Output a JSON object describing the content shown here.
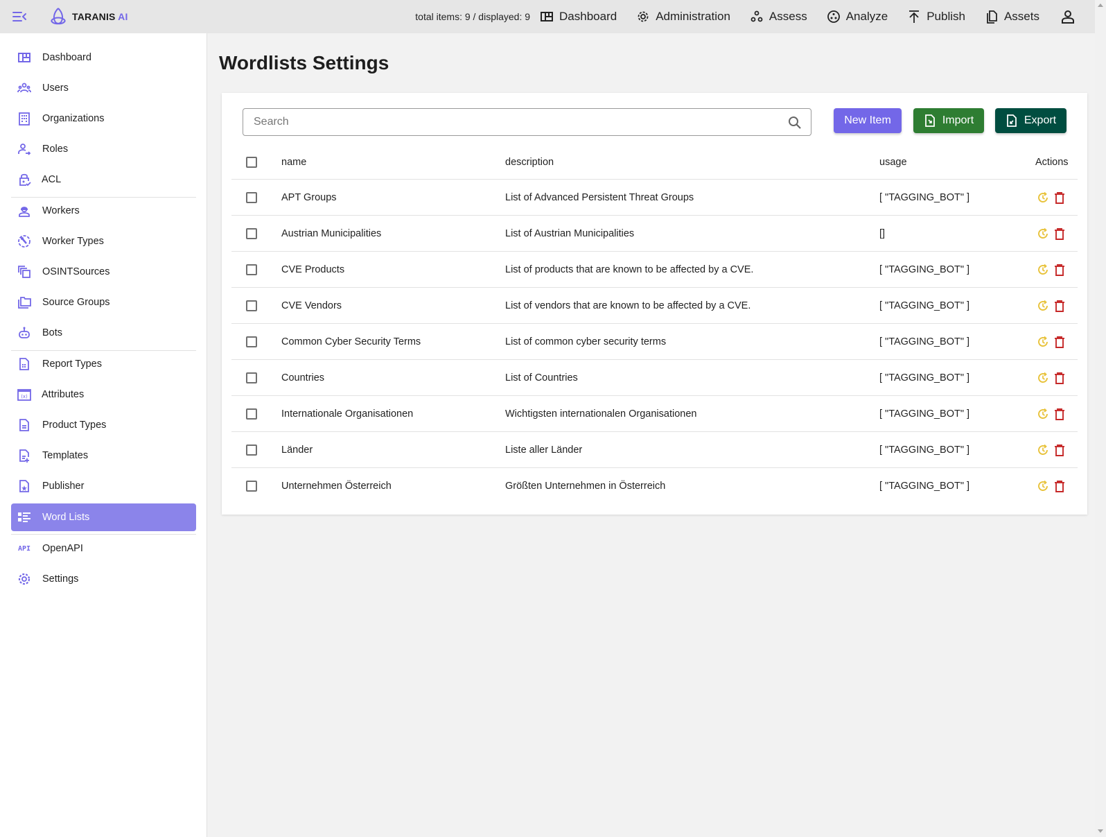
{
  "app": {
    "brand": "TARANIS",
    "brand_suffix": "AI"
  },
  "topnav": {
    "counter": "total items: 9 / displayed: 9",
    "items": [
      {
        "label": "Dashboard",
        "icon": "dashboard-icon"
      },
      {
        "label": "Administration",
        "icon": "gear-icon"
      },
      {
        "label": "Assess",
        "icon": "assess-icon"
      },
      {
        "label": "Analyze",
        "icon": "analyze-icon"
      },
      {
        "label": "Publish",
        "icon": "publish-icon"
      },
      {
        "label": "Assets",
        "icon": "assets-icon"
      }
    ],
    "user_icon": "user-icon"
  },
  "sidebar": {
    "items": [
      {
        "label": "Dashboard",
        "icon": "dashboard-icon"
      },
      {
        "label": "Users",
        "icon": "users-icon"
      },
      {
        "label": "Organizations",
        "icon": "building-icon"
      },
      {
        "label": "Roles",
        "icon": "roles-icon"
      },
      {
        "label": "ACL",
        "icon": "lock-check-icon"
      },
      {
        "label": "Workers",
        "icon": "worker-icon"
      },
      {
        "label": "Worker Types",
        "icon": "wrench-circle-icon"
      },
      {
        "label": "OSINTSources",
        "icon": "copy-icon"
      },
      {
        "label": "Source Groups",
        "icon": "folders-icon"
      },
      {
        "label": "Bots",
        "icon": "robot-icon"
      },
      {
        "label": "Report Types",
        "icon": "report-icon"
      },
      {
        "label": "Attributes",
        "icon": "variable-icon"
      },
      {
        "label": "Product Types",
        "icon": "document-icon"
      },
      {
        "label": "Templates",
        "icon": "document-plus-icon"
      },
      {
        "label": "Publisher",
        "icon": "document-star-icon"
      },
      {
        "label": "Word Lists",
        "icon": "list-icon",
        "active": true
      },
      {
        "label": "OpenAPI",
        "icon": "api-icon"
      },
      {
        "label": "Settings",
        "icon": "gear-icon"
      }
    ],
    "api_glyph": "API"
  },
  "main": {
    "title": "Wordlists Settings",
    "search": {
      "placeholder": "Search",
      "value": ""
    },
    "buttons": {
      "new_item": "New Item",
      "import": "Import",
      "export": "Export"
    },
    "table": {
      "headers": {
        "name": "name",
        "description": "description",
        "usage": "usage",
        "actions": "Actions"
      },
      "rows": [
        {
          "name": "APT Groups",
          "description": "List of Advanced Persistent Threat Groups",
          "usage": "[ \"TAGGING_BOT\" ]"
        },
        {
          "name": "Austrian Municipalities",
          "description": "List of Austrian Municipalities",
          "usage": "[]"
        },
        {
          "name": "CVE Products",
          "description": "List of products that are known to be affected by a CVE.",
          "usage": "[ \"TAGGING_BOT\" ]"
        },
        {
          "name": "CVE Vendors",
          "description": "List of vendors that are known to be affected by a CVE.",
          "usage": "[ \"TAGGING_BOT\" ]"
        },
        {
          "name": "Common Cyber Security Terms",
          "description": "List of common cyber security terms",
          "usage": "[ \"TAGGING_BOT\" ]"
        },
        {
          "name": "Countries",
          "description": "List of Countries",
          "usage": "[ \"TAGGING_BOT\" ]"
        },
        {
          "name": "Internationale Organisationen",
          "description": "Wichtigsten internationalen Organisationen",
          "usage": "[ \"TAGGING_BOT\" ]"
        },
        {
          "name": "Länder",
          "description": "Liste aller Länder",
          "usage": "[ \"TAGGING_BOT\" ]"
        },
        {
          "name": "Unternehmen Österreich",
          "description": "Größten Unternehmen in Österreich",
          "usage": "[ \"TAGGING_BOT\" ]"
        }
      ]
    }
  },
  "colors": {
    "primary": "#7367e8",
    "sidebar_active": "#8b84ea",
    "import": "#2e7d32",
    "export": "#004d40",
    "update_action": "#e8c23a",
    "delete_action": "#c62828"
  }
}
